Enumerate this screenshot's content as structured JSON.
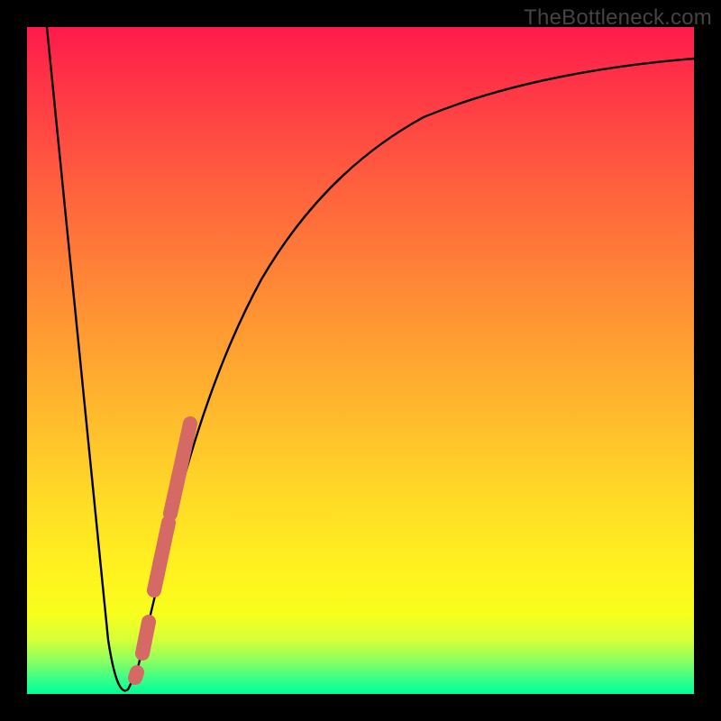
{
  "watermark": "TheBottleneck.com",
  "colors": {
    "frame": "#000000",
    "curve": "#000000",
    "marker": "#d46a63",
    "gradient_stops": [
      "#ff1a4b",
      "#ff3347",
      "#ff5b3f",
      "#ff8636",
      "#ffb22e",
      "#ffd927",
      "#fff31f",
      "#f8ff1c",
      "#d4ff3a",
      "#8cff62",
      "#3fff86",
      "#00ff99"
    ]
  },
  "chart_data": {
    "type": "line",
    "title": "",
    "xlabel": "",
    "ylabel": "",
    "xlim": [
      0,
      100
    ],
    "ylim": [
      0,
      100
    ],
    "note": "y represents bottleneck percentage; 0 at bottom (green) is ideal. x is relative component performance. Values estimated from pixel positions.",
    "series": [
      {
        "name": "bottleneck-curve",
        "x": [
          3,
          5,
          7,
          9,
          11,
          12,
          13,
          14.5,
          16,
          18,
          20,
          23,
          26,
          30,
          35,
          40,
          46,
          53,
          60,
          68,
          76,
          84,
          92,
          100
        ],
        "values": [
          100,
          83,
          65,
          47,
          28,
          14,
          3,
          0,
          3,
          12,
          22,
          35,
          47,
          57,
          66,
          73,
          79,
          83.5,
          87,
          89.5,
          91.5,
          93,
          94.2,
          95
        ]
      }
    ],
    "markers": [
      {
        "name": "point-a",
        "x": 16.5,
        "y": 3
      },
      {
        "name": "segment-b-start",
        "x": 17.3,
        "y": 6
      },
      {
        "name": "segment-b-end",
        "x": 18.2,
        "y": 11
      },
      {
        "name": "segment-c-start",
        "x": 19.0,
        "y": 15
      },
      {
        "name": "segment-c-end",
        "x": 21.2,
        "y": 26
      },
      {
        "name": "segment-d-start",
        "x": 21.5,
        "y": 27
      },
      {
        "name": "segment-d-end",
        "x": 24.5,
        "y": 41
      }
    ]
  }
}
